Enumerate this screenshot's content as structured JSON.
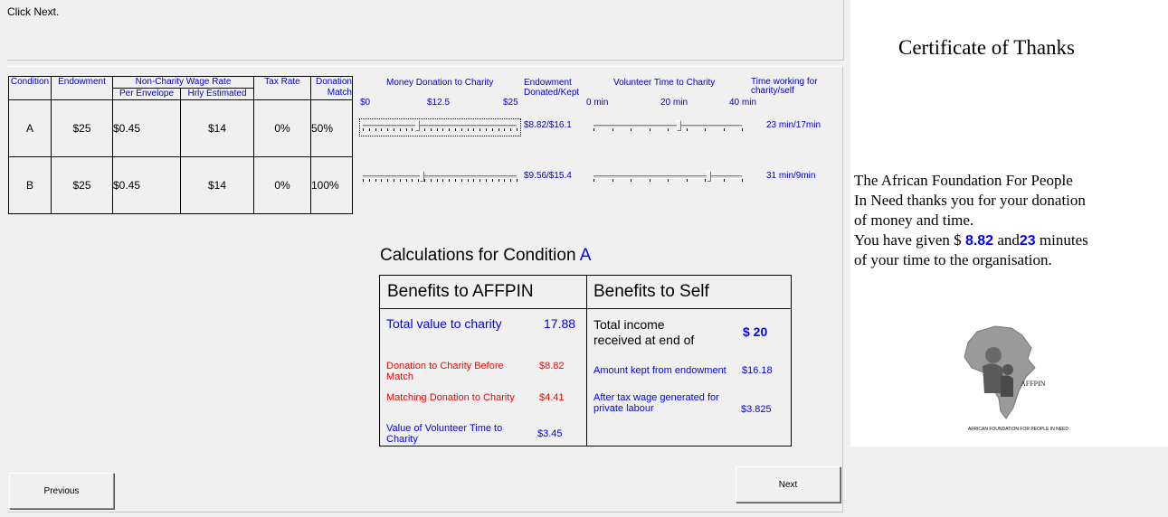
{
  "instruction": "Click Next.",
  "table": {
    "headers": {
      "condition": "Condition",
      "endowment": "Endowment",
      "wage_group": "Non-Charity Wage Rate",
      "per_envelope": "Per Envelope",
      "hrly_estimated": "Hrly Estimated",
      "tax_rate": "Tax Rate",
      "donation_match": "Donation Match"
    },
    "rows": [
      {
        "condition": "A",
        "endowment": "$25",
        "per_envelope": "$0.45",
        "hrly": "$14",
        "tax": "0%",
        "match": "50%"
      },
      {
        "condition": "B",
        "endowment": "$25",
        "per_envelope": "$0.45",
        "hrly": "$14",
        "tax": "0%",
        "match": "100%"
      }
    ]
  },
  "sliders": {
    "money_header": "Money Donation to Charity",
    "money_ticks": [
      "$0",
      "$12.5",
      "$25"
    ],
    "endow_header": "Endowment Donated/Kept",
    "volunteer_header": "Volunteer Time to Charity",
    "volunteer_ticks": [
      "0 min",
      "20 min",
      "40 min"
    ],
    "time_header": "Time working for charity/self",
    "rows": [
      {
        "money_fraction": 0.3528,
        "endow_text": "$8.82/$16.1",
        "volunteer_fraction": 0.575,
        "time_text": "23 min/17min"
      },
      {
        "money_fraction": 0.3824,
        "endow_text": "$9.56/$15.4",
        "volunteer_fraction": 0.775,
        "time_text": "31 min/9min"
      }
    ]
  },
  "calc": {
    "title_prefix": "Calculations for Condition",
    "condition": "A",
    "affpin_header": "Benefits to AFFPIN",
    "self_header": "Benefits to Self",
    "total_value_label": "Total value to charity",
    "total_value": "17.88",
    "donation_before_label": "Donation to Charity Before Match",
    "donation_before": "$8.82",
    "matching_label": "Matching Donation to Charity",
    "matching": "$4.41",
    "volunteer_label": "Value of Volunteer Time to Charity",
    "volunteer_value": "$3.45",
    "total_income_label": "Total income received at end of",
    "total_income": "$ 20",
    "kept_label": "Amount kept from endowment",
    "kept": "$16.18",
    "aftertax_label": "After tax wage generated for private labour",
    "aftertax": "$3.825"
  },
  "buttons": {
    "previous": "Previous",
    "next": "Next"
  },
  "certificate": {
    "title": "Certificate of Thanks",
    "line1": "The African Foundation For People",
    "line2": "In Need thanks you for your donation",
    "line3": "of money and time.",
    "line4_prefix": "You have given $",
    "money": "8.82",
    "line4_and": "and",
    "minutes": "23",
    "line4_suffix": "minutes",
    "line5": "of your time to the organisation.",
    "logo_mark": "AFFPIN",
    "logo_caption": "AFRICAN FOUNDATION FOR PEOPLE IN NEED"
  }
}
